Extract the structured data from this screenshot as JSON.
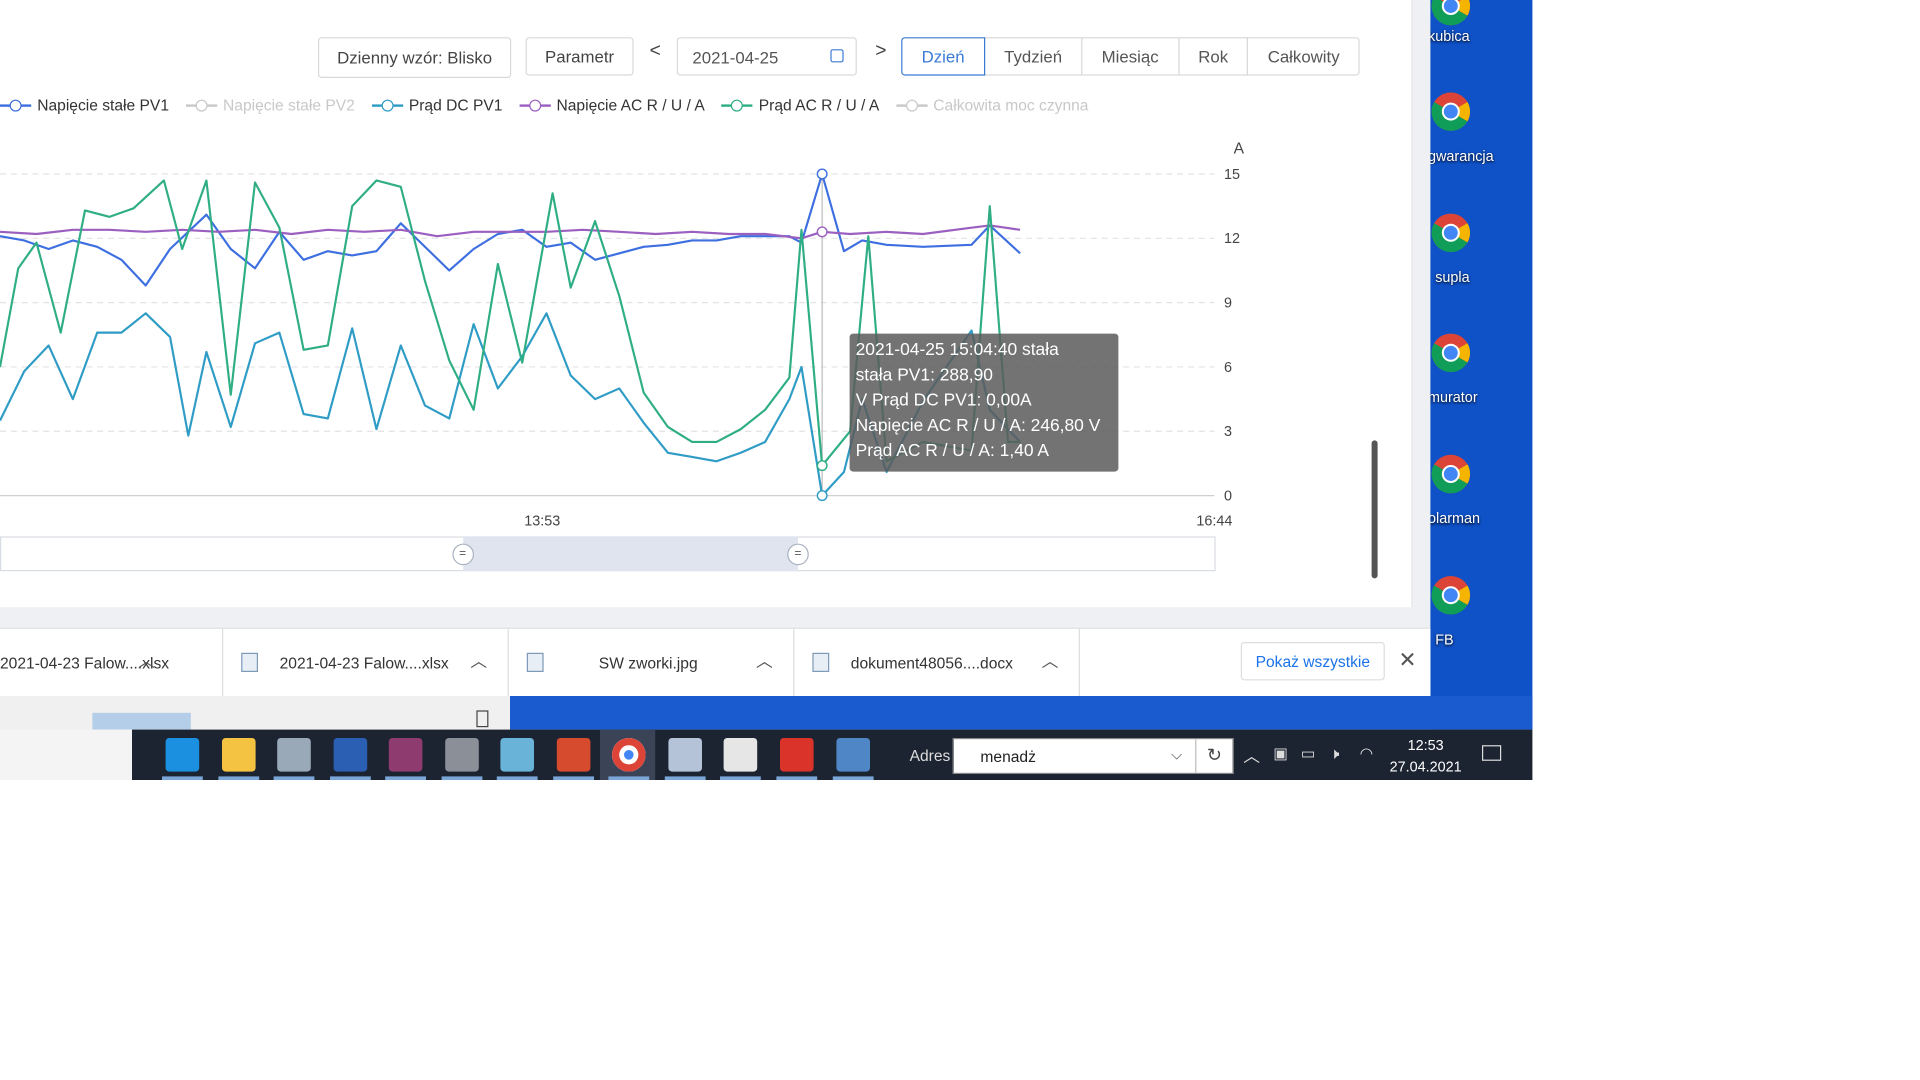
{
  "toolbar": {
    "pattern_label": "Dzienny wzór: Blisko",
    "parameter_label": "Parametr",
    "prev_label": "<",
    "next_label": ">",
    "date_value": "2021-04-25",
    "ranges": [
      "Dzień",
      "Tydzień",
      "Miesiąc",
      "Rok",
      "Całkowity"
    ],
    "active_range": "Dzień"
  },
  "legend": [
    {
      "label": "Napięcie stałe PV1",
      "color": "#3d6fe0",
      "active": true
    },
    {
      "label": "Napięcie stałe PV2",
      "color": "#c8c8c8",
      "active": false
    },
    {
      "label": "Prąd DC PV1",
      "color": "#2f9cc6",
      "active": true
    },
    {
      "label": "Napięcie AC R / U / A",
      "color": "#9b5fc0",
      "active": true
    },
    {
      "label": "Prąd AC R / U / A",
      "color": "#2fae85",
      "active": true
    },
    {
      "label": "Całkowita moc czynna",
      "color": "#c8c8c8",
      "active": false
    }
  ],
  "chart_data": {
    "type": "line",
    "y_unit_label": "A",
    "yticks": [
      "15",
      "12",
      "9",
      "6",
      "3",
      "0"
    ],
    "ylim": [
      0,
      15
    ],
    "xlim": [
      0,
      1.0
    ],
    "x_tick_labels": [
      {
        "label": "13:53",
        "pos": 0.4465
      },
      {
        "label": "16:44",
        "pos": 1.0
      }
    ],
    "grid": true,
    "series": [
      {
        "name": "Napięcie stałe PV1",
        "color": "#3d6fe0",
        "points": [
          [
            0,
            12.1
          ],
          [
            0.02,
            11.9
          ],
          [
            0.04,
            11.5
          ],
          [
            0.06,
            11.9
          ],
          [
            0.08,
            11.6
          ],
          [
            0.1,
            11.0
          ],
          [
            0.12,
            9.8
          ],
          [
            0.14,
            11.5
          ],
          [
            0.17,
            13.1
          ],
          [
            0.19,
            11.5
          ],
          [
            0.21,
            10.6
          ],
          [
            0.23,
            12.3
          ],
          [
            0.25,
            11.0
          ],
          [
            0.27,
            11.4
          ],
          [
            0.29,
            11.2
          ],
          [
            0.31,
            11.4
          ],
          [
            0.33,
            12.7
          ],
          [
            0.35,
            11.6
          ],
          [
            0.37,
            10.5
          ],
          [
            0.39,
            11.5
          ],
          [
            0.41,
            12.2
          ],
          [
            0.43,
            12.4
          ],
          [
            0.45,
            11.6
          ],
          [
            0.47,
            11.8
          ],
          [
            0.49,
            11.0
          ],
          [
            0.51,
            11.3
          ],
          [
            0.53,
            11.6
          ],
          [
            0.55,
            11.7
          ],
          [
            0.57,
            11.9
          ],
          [
            0.59,
            11.9
          ],
          [
            0.61,
            12.1
          ],
          [
            0.63,
            12.1
          ],
          [
            0.65,
            12.1
          ],
          [
            0.66,
            11.8
          ],
          [
            0.677,
            15.0
          ],
          [
            0.695,
            11.4
          ],
          [
            0.71,
            11.9
          ],
          [
            0.73,
            11.7
          ],
          [
            0.76,
            11.6
          ],
          [
            0.8,
            11.7
          ],
          [
            0.815,
            12.6
          ],
          [
            0.84,
            11.3
          ]
        ]
      },
      {
        "name": "Napięcie AC R / U / A",
        "color": "#9b5fc0",
        "points": [
          [
            0,
            12.3
          ],
          [
            0.03,
            12.2
          ],
          [
            0.06,
            12.4
          ],
          [
            0.09,
            12.4
          ],
          [
            0.12,
            12.3
          ],
          [
            0.15,
            12.4
          ],
          [
            0.18,
            12.3
          ],
          [
            0.21,
            12.4
          ],
          [
            0.24,
            12.2
          ],
          [
            0.27,
            12.4
          ],
          [
            0.3,
            12.3
          ],
          [
            0.33,
            12.4
          ],
          [
            0.36,
            12.1
          ],
          [
            0.39,
            12.3
          ],
          [
            0.42,
            12.3
          ],
          [
            0.45,
            12.3
          ],
          [
            0.48,
            12.4
          ],
          [
            0.51,
            12.3
          ],
          [
            0.54,
            12.2
          ],
          [
            0.57,
            12.3
          ],
          [
            0.6,
            12.2
          ],
          [
            0.63,
            12.2
          ],
          [
            0.66,
            12.0
          ],
          [
            0.677,
            12.3
          ],
          [
            0.7,
            12.2
          ],
          [
            0.73,
            12.3
          ],
          [
            0.76,
            12.2
          ],
          [
            0.8,
            12.5
          ],
          [
            0.815,
            12.6
          ],
          [
            0.84,
            12.4
          ]
        ]
      },
      {
        "name": "Prąd DC PV1",
        "color": "#2f9cc6",
        "points": [
          [
            0,
            3.5
          ],
          [
            0.02,
            5.8
          ],
          [
            0.04,
            7.0
          ],
          [
            0.06,
            4.5
          ],
          [
            0.08,
            7.6
          ],
          [
            0.1,
            7.6
          ],
          [
            0.12,
            8.5
          ],
          [
            0.14,
            7.4
          ],
          [
            0.155,
            2.8
          ],
          [
            0.17,
            6.7
          ],
          [
            0.19,
            3.2
          ],
          [
            0.21,
            7.1
          ],
          [
            0.23,
            7.6
          ],
          [
            0.25,
            3.8
          ],
          [
            0.27,
            3.6
          ],
          [
            0.29,
            7.8
          ],
          [
            0.31,
            3.1
          ],
          [
            0.33,
            7.0
          ],
          [
            0.35,
            4.2
          ],
          [
            0.37,
            3.6
          ],
          [
            0.39,
            8.0
          ],
          [
            0.41,
            5.0
          ],
          [
            0.43,
            6.5
          ],
          [
            0.45,
            8.5
          ],
          [
            0.47,
            5.6
          ],
          [
            0.49,
            4.5
          ],
          [
            0.51,
            5.0
          ],
          [
            0.53,
            3.4
          ],
          [
            0.55,
            2.0
          ],
          [
            0.57,
            1.8
          ],
          [
            0.59,
            1.6
          ],
          [
            0.61,
            2.0
          ],
          [
            0.63,
            2.5
          ],
          [
            0.65,
            4.5
          ],
          [
            0.66,
            6.0
          ],
          [
            0.677,
            0.0
          ],
          [
            0.695,
            1.1
          ],
          [
            0.71,
            4.5
          ],
          [
            0.73,
            1.1
          ],
          [
            0.76,
            4.4
          ],
          [
            0.8,
            7.7
          ],
          [
            0.815,
            4.0
          ],
          [
            0.84,
            2.5
          ]
        ]
      },
      {
        "name": "Prąd AC R / U / A",
        "color": "#2fae85",
        "points": [
          [
            0,
            6.0
          ],
          [
            0.015,
            10.6
          ],
          [
            0.03,
            11.8
          ],
          [
            0.05,
            7.6
          ],
          [
            0.07,
            13.3
          ],
          [
            0.09,
            13.0
          ],
          [
            0.11,
            13.4
          ],
          [
            0.135,
            14.7
          ],
          [
            0.15,
            11.5
          ],
          [
            0.17,
            14.7
          ],
          [
            0.19,
            4.7
          ],
          [
            0.21,
            14.6
          ],
          [
            0.23,
            12.5
          ],
          [
            0.25,
            6.8
          ],
          [
            0.27,
            7.0
          ],
          [
            0.29,
            13.5
          ],
          [
            0.31,
            14.7
          ],
          [
            0.33,
            14.4
          ],
          [
            0.35,
            10.0
          ],
          [
            0.37,
            6.3
          ],
          [
            0.39,
            4.0
          ],
          [
            0.41,
            10.8
          ],
          [
            0.43,
            6.2
          ],
          [
            0.455,
            14.1
          ],
          [
            0.47,
            9.7
          ],
          [
            0.49,
            12.8
          ],
          [
            0.51,
            9.3
          ],
          [
            0.53,
            4.8
          ],
          [
            0.55,
            3.2
          ],
          [
            0.57,
            2.5
          ],
          [
            0.59,
            2.5
          ],
          [
            0.61,
            3.1
          ],
          [
            0.63,
            4.0
          ],
          [
            0.65,
            5.5
          ],
          [
            0.66,
            12.4
          ],
          [
            0.677,
            1.4
          ],
          [
            0.7,
            3.0
          ],
          [
            0.715,
            12.1
          ],
          [
            0.73,
            1.6
          ],
          [
            0.76,
            2.5
          ],
          [
            0.8,
            2.1
          ],
          [
            0.815,
            13.5
          ],
          [
            0.83,
            2.5
          ],
          [
            0.84,
            2.5
          ]
        ]
      }
    ],
    "cursor_x": 0.677
  },
  "tooltip": {
    "line1": "2021-04-25 15:04:40 stała",
    "line2": "stała PV1: 288,90",
    "line3": "V Prąd DC PV1: 0,00A",
    "line4": "Napięcie AC R / U / A: 246,80 V",
    "line5": "Prąd AC R / U / A: 1,40 A"
  },
  "zoom_slider": {
    "start": 0.381,
    "end": 0.657
  },
  "downloads": [
    {
      "name": "2021-04-23 Falow....xlsx"
    },
    {
      "name": "2021-04-23 Falow....xlsx"
    },
    {
      "name": "SW zworki.jpg"
    },
    {
      "name": "dokument48056....docx"
    }
  ],
  "show_all_label": "Pokaż wszystkie",
  "desktop_icons": [
    {
      "label": "kubica"
    },
    {
      "label": "gwarancja"
    },
    {
      "label": "supla"
    },
    {
      "label": "murator"
    },
    {
      "label": "olarman"
    },
    {
      "label": "FB"
    }
  ],
  "taskbar": {
    "address_label": "Adres",
    "address_value": "menadż",
    "time": "12:53",
    "date": "27.04.2021"
  },
  "colors": {
    "accent": "#3a7bd5",
    "desktop": "#0f51c6",
    "taskbar": "#1c2331"
  }
}
